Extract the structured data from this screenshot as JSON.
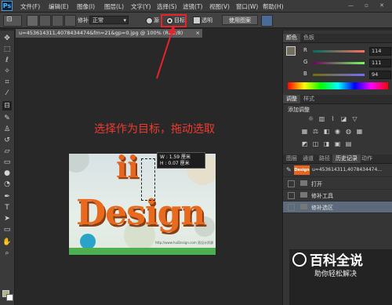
{
  "app": {
    "logo": "Ps"
  },
  "menu": [
    "文件(F)",
    "编辑(E)",
    "图像(I)",
    "图层(L)",
    "文字(Y)",
    "选择(S)",
    "滤镜(T)",
    "视图(V)",
    "窗口(W)",
    "帮助(H)"
  ],
  "window_controls": "— ▫ ✕",
  "options_bar": {
    "patch_label": "修补 :",
    "patch_mode": "正常",
    "source_label": "源",
    "target_label": "目标",
    "transparent_label": "透明",
    "use_pattern_label": "使用图案"
  },
  "document": {
    "tab_title": "u=453614311,4078434474&fm=21&gp=0.jpg @ 100% (RGB/8)",
    "close": "×"
  },
  "annotation": {
    "instruction": "选择作为目标，拖动选取",
    "highlight_color": "#e8242a"
  },
  "image": {
    "big_i": "ii",
    "word": "Design",
    "footer_url": "http://www.huiDesign.com 亮设计资源"
  },
  "tooltip": {
    "w": "W : 1.59 厘米",
    "h": "H : 0.07 厘米"
  },
  "color_panel": {
    "tabs": [
      "颜色",
      "色板"
    ],
    "channels": [
      {
        "label": "R",
        "value": "114"
      },
      {
        "label": "G",
        "value": "111"
      },
      {
        "label": "B",
        "value": "94"
      }
    ],
    "foreground": "#726f5e"
  },
  "adjust_panel": {
    "tabs": [
      "调整",
      "样式"
    ],
    "title": "添加调整"
  },
  "history_panel": {
    "tabs": [
      "图层",
      "通道",
      "路径",
      "历史记录",
      "动作"
    ],
    "snapshot": "u=453614311,4078434474...",
    "snapshot_thumb": "Design",
    "items": [
      "打开",
      "修补工具",
      "修补选区"
    ]
  },
  "watermark": {
    "title": "百科全说",
    "subtitle": "助你轻松解决"
  }
}
